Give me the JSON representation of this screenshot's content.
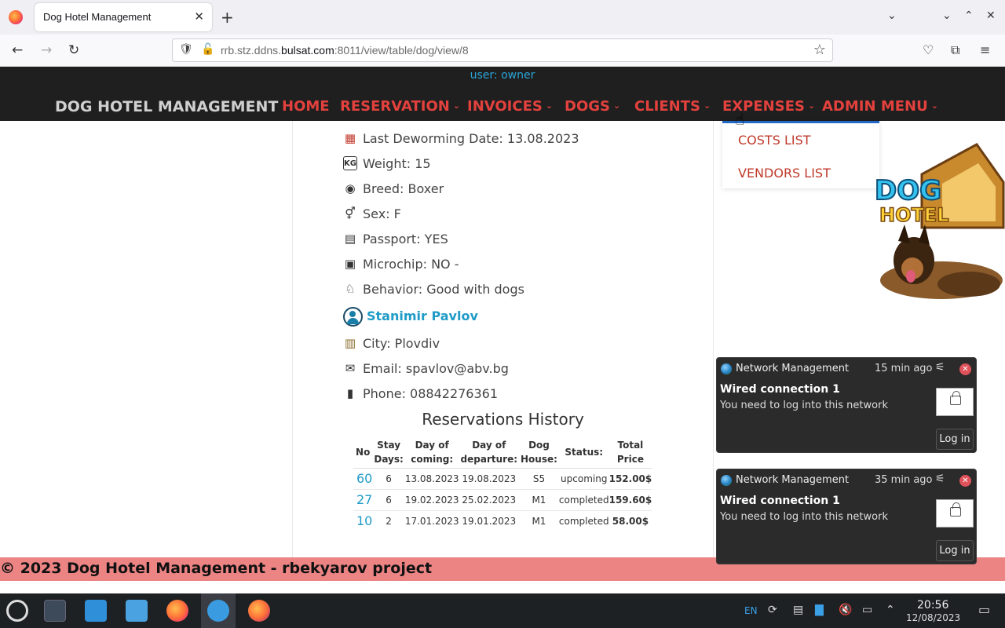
{
  "browser": {
    "tab_title": "Dog Hotel Management",
    "url_prefix": "rrb.stz.ddns.",
    "url_domain": "bulsat.com",
    "url_suffix": ":8011/view/table/dog/view/8"
  },
  "header": {
    "user_line": "user: owner",
    "brand": "DOG HOTEL MANAGEMENT",
    "menu": {
      "home": "HOME",
      "reservation": "RESERVATION",
      "invoices": "INVOICES",
      "dogs": "DOGS",
      "clients": "CLIENTS",
      "expenses": "EXPENSES",
      "admin": "ADMIN MENU"
    }
  },
  "expenses_dropdown": {
    "costs": "COSTS LIST",
    "vendors": "VENDORS LIST"
  },
  "logo": {
    "line1": "DOG",
    "line2": "HOTEL"
  },
  "dog": {
    "deworming": "Last Deworming Date: 13.08.2023",
    "weight": "Weight: 15",
    "breed": "Breed: Boxer",
    "sex": "Sex: F",
    "passport": "Passport: YES",
    "microchip": "Microchip: NO -",
    "behavior": "Behavior: Good with dogs"
  },
  "owner": {
    "name": "Stanimir Pavlov",
    "city": "City: Plovdiv",
    "email": "Email: spavlov@abv.bg",
    "phone": "Phone: 08842276361"
  },
  "reservations": {
    "title": "Reservations History",
    "headers": {
      "no": "No",
      "stay1": "Stay",
      "stay2": "Days:",
      "coming1": "Day of",
      "coming2": "coming:",
      "departure1": "Day of",
      "departure2": "departure:",
      "house1": "Dog",
      "house2": "House:",
      "status": "Status:",
      "price1": "Total",
      "price2": "Price"
    },
    "rows": [
      {
        "no": "60",
        "days": "6",
        "coming": "13.08.2023",
        "departure": "19.08.2023",
        "house": "S5",
        "status": "upcoming",
        "price": "152.00$"
      },
      {
        "no": "27",
        "days": "6",
        "coming": "19.02.2023",
        "departure": "25.02.2023",
        "house": "M1",
        "status": "completed",
        "price": "159.60$"
      },
      {
        "no": "10",
        "days": "2",
        "coming": "17.01.2023",
        "departure": "19.01.2023",
        "house": "M1",
        "status": "completed",
        "price": "58.00$"
      }
    ]
  },
  "footer": {
    "text": "© 2023 Dog Hotel Management - rbekyarov project"
  },
  "notifications": [
    {
      "app": "Network Management",
      "time": "15 min ago",
      "title": "Wired connection 1",
      "body": "You need to log into this network",
      "button": "Log in"
    },
    {
      "app": "Network Management",
      "time": "35 min ago",
      "title": "Wired connection 1",
      "body": "You need to log into this network",
      "button": "Log in"
    }
  ],
  "taskbar": {
    "lang": "EN",
    "time": "20:56",
    "date": "12/08/2023"
  },
  "colors": {
    "header_bg": "#1f1f1f",
    "menu_red": "#e3413d",
    "link_blue": "#1e9bc7",
    "footer_bg": "#ec8484"
  }
}
